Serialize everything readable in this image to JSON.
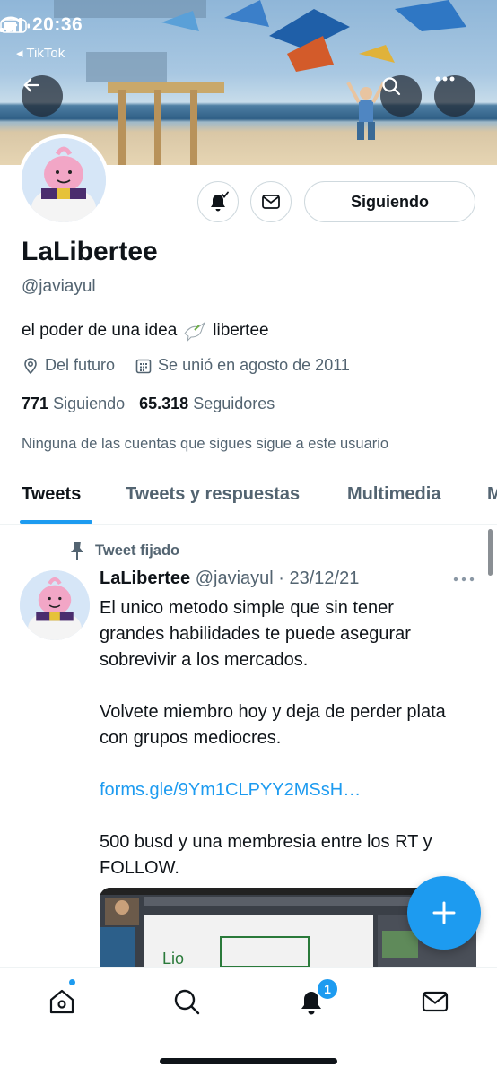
{
  "status_bar": {
    "time": "20:36",
    "back_app": "◂ TikTok"
  },
  "header": {
    "back_icon": "arrow-left-icon",
    "search_icon": "search-icon",
    "more_icon": "more-horizontal-icon"
  },
  "profile": {
    "name": "LaLibertee",
    "handle": "@javiayul",
    "bio_text": "el poder de una idea",
    "bio_suffix": "libertee",
    "location": "Del futuro",
    "joined": "Se unió en agosto de 2011",
    "following_count": "771",
    "following_label": "Siguiendo",
    "followers_count": "65.318",
    "followers_label": "Seguidores",
    "follow_note": "Ninguna de las cuentas que sigues sigue a este usuario",
    "following_button": "Siguiendo"
  },
  "tabs": [
    {
      "label": "Tweets",
      "active": true
    },
    {
      "label": "Tweets y respuestas",
      "active": false
    },
    {
      "label": "Multimedia",
      "active": false
    },
    {
      "label": "M",
      "active": false
    }
  ],
  "tweet": {
    "pinned_label": "Tweet fijado",
    "author": "LaLibertee",
    "meta": "@javiayul · 23/12/21",
    "body_1": "El unico metodo simple que sin tener grandes habilidades te puede asegurar sobrevivir a los mercados.",
    "body_2": "Volvete miembro hoy y deja de perder plata con grupos mediocres.",
    "link": "forms.gle/9Ym1CLPYY2MSsH…",
    "body_3": "500 busd y una membresia entre los RT y FOLLOW."
  },
  "bottom_nav": {
    "notifications_badge": "1"
  },
  "colors": {
    "accent": "#1d9bf0",
    "text_primary": "#0f1419",
    "text_secondary": "#536471",
    "border": "#cfd9de"
  }
}
